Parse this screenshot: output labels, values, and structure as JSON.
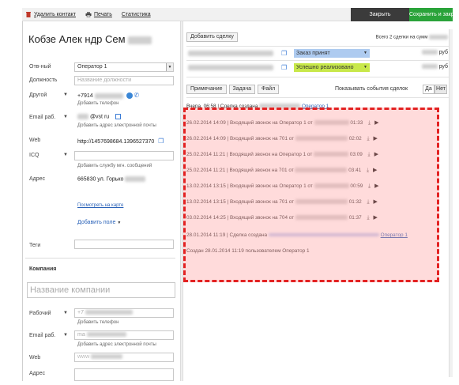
{
  "toolbar": {
    "delete_label": "Удалить контакт",
    "print_label": "Печать",
    "stats_label": "Статистика",
    "close_label": "Закрыть",
    "save_close_label": "Сохранить и закрыть"
  },
  "contact": {
    "name": "Кобзе Алек   ндр Сем",
    "responsible_label": "Отв-ный",
    "responsible_value": "Оператор 1",
    "position_label": "Должность",
    "position_placeholder": "Название должности",
    "other_label": "Другой",
    "other_value": "+7914",
    "add_phone": "Добавить телефон",
    "email_label": "Email раб.",
    "email_value": "@vst         ru",
    "add_email": "Добавить адрес электронной почты",
    "web_label": "Web",
    "web_value": "http://1457698684.1396527370",
    "icq_label": "ICQ",
    "add_im": "Добавить службу мгн. сообщений",
    "address_label": "Адрес",
    "address_value": "665830 ул. Горько",
    "show_map": "Посмотреть на карте",
    "add_field": "Добавить поле",
    "tags_label": "Теги"
  },
  "company": {
    "section_title": "Компания",
    "name_placeholder": "Название компании",
    "work_label": "Рабочий",
    "work_value": "+7",
    "add_phone": "Добавить телефон",
    "email_label": "Email раб.",
    "email_value": "ma",
    "add_email": "Добавить адрес электронной почты",
    "web_label": "Web",
    "web_value": "www",
    "address_label": "Адрес"
  },
  "deals": {
    "add_button": "Добавить сделку",
    "total": "Всего 2 сделки на сумм",
    "rows": [
      {
        "status": "Заказ принят",
        "currency": "руб",
        "color": "#aecbf0"
      },
      {
        "status": "Успешно реализовано",
        "currency": "руб",
        "color": "#c8e84a"
      }
    ]
  },
  "events_tabs": {
    "note": "Примечание",
    "task": "Задача",
    "file": "Файл",
    "show_events": "Показывать события сделок",
    "yes": "Да",
    "no": "Нет"
  },
  "events": [
    {
      "text": "Вчера, 06:58 | Сделка создана",
      "link": "Оператор 1"
    },
    {
      "text": "26.02.2014 14:09 | Входящий звонок на Оператор 1 от",
      "duration": "01:33"
    },
    {
      "text": "26.02.2014 14:09 | Входящий звонок на 701 от",
      "duration": "02:02"
    },
    {
      "text": "25.02.2014 11:21 | Входящий звонок на Оператор 1 от",
      "duration": "03:09"
    },
    {
      "text": "25.02.2014 11:21 | Входящий звонок на 701 от",
      "duration": "03:41"
    },
    {
      "text": "13.02.2014 13:15 | Входящий звонок на Оператор 1 от",
      "duration": "00:59"
    },
    {
      "text": "13.02.2014 13:15 | Входящий звонок на 701 от",
      "duration": "01:32"
    },
    {
      "text": "03.02.2014 14:25 | Входящий звонок на 704 от",
      "duration": "01:37"
    },
    {
      "text": "28.01.2014 11:19 | Сделка создана",
      "link": "Оператор 1"
    },
    {
      "text": "Создан 28.01.2014 11:19 пользователем Оператор 1"
    }
  ]
}
